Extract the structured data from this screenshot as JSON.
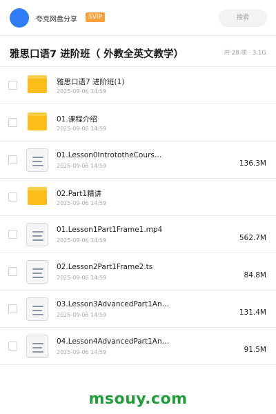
{
  "header": {
    "app_name": "夸克网盘分享",
    "badge": "SVIP",
    "search_placeholder": "搜索"
  },
  "title_bar": {
    "title": "雅思口语7 进阶班（ 外教全英文教学）",
    "summary": "共 28 项 · 3.1G"
  },
  "files": [
    {
      "type": "folder",
      "icon": "folder-icon",
      "name": "雅思口语7 进阶班(1)",
      "date": "2025-09-06 14:59",
      "size": ""
    },
    {
      "type": "folder",
      "icon": "folder-icon",
      "name": "01.课程介绍",
      "date": "2025-09-06 14:59",
      "size": ""
    },
    {
      "type": "file",
      "icon": "file-icon",
      "name": "01.Lesson0IntrototheCours…",
      "date": "2025-09-06 14:59",
      "size": "136.3M"
    },
    {
      "type": "folder",
      "icon": "folder-icon",
      "name": "02.Part1精讲",
      "date": "2025-09-06 14:59",
      "size": ""
    },
    {
      "type": "file",
      "icon": "file-icon",
      "name": "01.Lesson1Part1Frame1.mp4",
      "date": "2025-09-06 14:59",
      "size": "562.7M"
    },
    {
      "type": "file",
      "icon": "file-icon",
      "name": "02.Lesson2Part1Frame2.ts",
      "date": "2025-09-06 14:59",
      "size": "84.8M"
    },
    {
      "type": "file",
      "icon": "file-icon",
      "name": "03.Lesson3AdvancedPart1An…",
      "date": "2025-09-06 14:59",
      "size": "131.4M"
    },
    {
      "type": "file",
      "icon": "file-icon",
      "name": "04.Lesson4AdvancedPart1An…",
      "date": "2025-09-06 14:59",
      "size": "91.5M"
    }
  ],
  "watermark": "msouy.com",
  "colors": {
    "avatar": "#2f7df6",
    "badge": "#f7a23b",
    "folder": "#fbbd17",
    "watermark": "#1f9d3a"
  }
}
